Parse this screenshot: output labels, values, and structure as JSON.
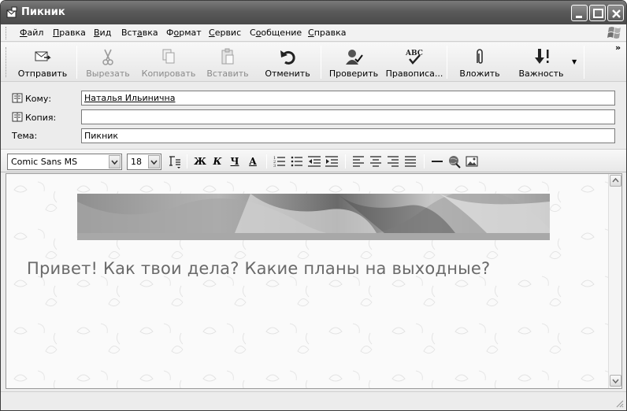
{
  "window": {
    "title": "Пикник"
  },
  "menu": {
    "items": [
      "Файл",
      "Правка",
      "Вид",
      "Вставка",
      "Формат",
      "Сервис",
      "Сообщение",
      "Справка"
    ],
    "accelerators": [
      "Ф",
      "П",
      "В",
      "а",
      "о",
      "С",
      "о",
      "С"
    ]
  },
  "toolbar": {
    "send": "Отправить",
    "cut": "Вырезать",
    "copy": "Копировать",
    "paste": "Вставить",
    "undo": "Отменить",
    "check": "Проверить",
    "spelling": "Правописа...",
    "attach": "Вложить",
    "priority": "Важность",
    "more": "»"
  },
  "header": {
    "to_label": "Кому:",
    "to_value": "Наталья Ильинична",
    "cc_label": "Копия:",
    "cc_value": "",
    "subject_label": "Тема:",
    "subject_value": "Пикник"
  },
  "format": {
    "font_name": "Comic Sans MS",
    "font_size": "18",
    "bold": "Ж",
    "italic": "К",
    "underline": "Ч",
    "color": "А"
  },
  "message": {
    "body": "Привет! Как твои дела? Какие планы на выходные?"
  },
  "colors": {
    "titlebar": "#5a5a5a",
    "chrome": "#ececec",
    "text_gray": "#6a6a6a"
  }
}
